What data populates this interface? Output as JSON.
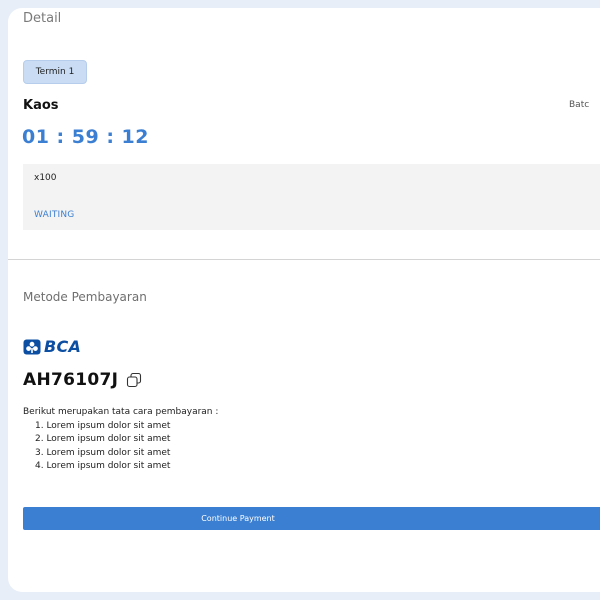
{
  "detail": {
    "title": "Detail",
    "tab_label": "Termin 1",
    "product_name": "Kaos",
    "batch_label": "Batc",
    "countdown": "01 : 59 : 12",
    "quantity": "x100",
    "status": "WAITING"
  },
  "payment": {
    "title": "Metode Pembayaran",
    "bank_name": "BCA",
    "va_number": "AH76107J",
    "instructions_title": "Berikut merupakan tata cara pembayaran :",
    "steps": [
      "1. Lorem ipsum dolor sit amet",
      "2. Lorem ipsum dolor sit amet",
      "3. Lorem ipsum dolor sit amet",
      "4. Lorem ipsum dolor sit amet"
    ],
    "continue_label": "Continue Payment"
  },
  "colors": {
    "accent": "#3b7fd3",
    "tab_bg": "#c9dcf4",
    "bank_brand": "#0b4ea2",
    "box_bg": "#f3f3f3",
    "page_bg": "#e7eef7"
  },
  "icons": {
    "bank": "bca-logo-icon",
    "copy": "copy-icon"
  }
}
